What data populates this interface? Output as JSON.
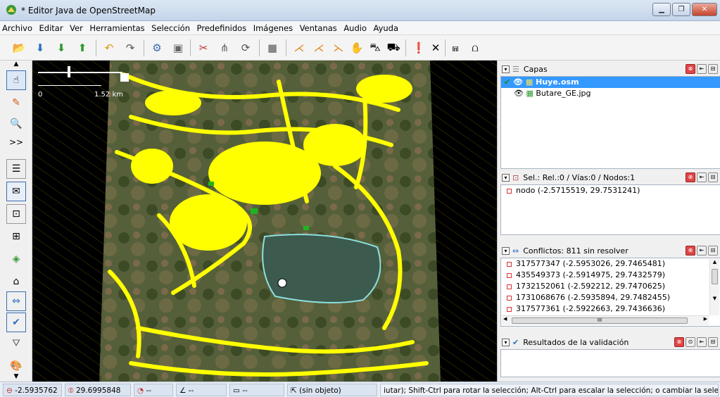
{
  "window": {
    "title": "* Editor Java de OpenStreetMap"
  },
  "menu": [
    "Archivo",
    "Editar",
    "Ver",
    "Herramientas",
    "Selección",
    "Predefinidos",
    "Imágenes",
    "Ventanas",
    "Audio",
    "Ayuda"
  ],
  "map": {
    "scale_left": "0",
    "scale_right": "1.52 km"
  },
  "layers": {
    "title": "Capas",
    "items": [
      {
        "label": "Huye.osm",
        "selected": true
      },
      {
        "label": "Butare_GE.jpg",
        "selected": false
      }
    ]
  },
  "selection": {
    "title": "Sel.: Rel.:0 / Vías:0 / Nodos:1",
    "items": [
      "nodo (-2.5715519, 29.7531241)"
    ]
  },
  "conflicts": {
    "title": "Conflictos: 811 sin resolver",
    "items": [
      "317577347 (-2.5953026, 29.7465481)",
      "435549373 (-2.5914975, 29.7432579)",
      "1732152061 (-2.592212, 29.7470625)",
      "1731068676 (-2.5935894, 29.7482455)",
      "317577361 (-2.5922663, 29.7436636)"
    ],
    "hscroll_mark": "III"
  },
  "validation": {
    "title": "Resultados de la validación"
  },
  "status": {
    "lat": "-2.5935762",
    "lon": "29.6995848",
    "heading": "--",
    "angle": "--",
    "distance": "--",
    "object": "(sin objeto)",
    "help": "iutar); Shift-Ctrl para rotar la selección; Alt-Ctrl para escalar la selección; o cambiar la selección"
  },
  "colors": {
    "selected_row": "#3399ff",
    "osm_data": "#ffff00",
    "status_bg": "#dbe4f1"
  }
}
